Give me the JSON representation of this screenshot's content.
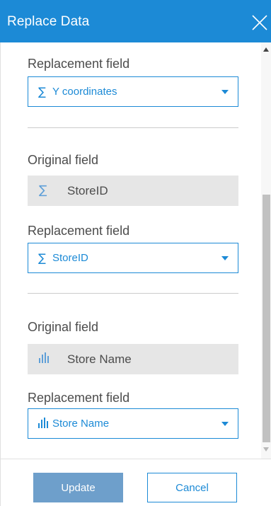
{
  "dialog": {
    "title": "Replace Data",
    "close_icon": "close-icon"
  },
  "sections": [
    {
      "replacement_label": "Replacement field",
      "replacement_icon": "∑",
      "replacement_icon_name": "sum-icon",
      "replacement_value": "Y coordinates"
    },
    {
      "original_label": "Original field",
      "original_icon": "∑",
      "original_icon_name": "sum-icon",
      "original_value": "StoreID",
      "replacement_label": "Replacement field",
      "replacement_icon": "∑",
      "replacement_icon_name": "sum-icon",
      "replacement_value": "StoreID"
    },
    {
      "original_label": "Original field",
      "original_icon": "ıllı",
      "original_icon_name": "bar-chart-icon",
      "original_value": "Store Name",
      "replacement_label": "Replacement field",
      "replacement_icon": "ıllı",
      "replacement_icon_name": "bar-chart-icon",
      "replacement_value": "Store Name"
    }
  ],
  "footer": {
    "update_label": "Update",
    "cancel_label": "Cancel"
  },
  "colors": {
    "header_bg": "#1c8ad6",
    "accent": "#1c8ad6",
    "update_bg": "#6e9fcb",
    "original_bg": "#e6e6e6"
  }
}
